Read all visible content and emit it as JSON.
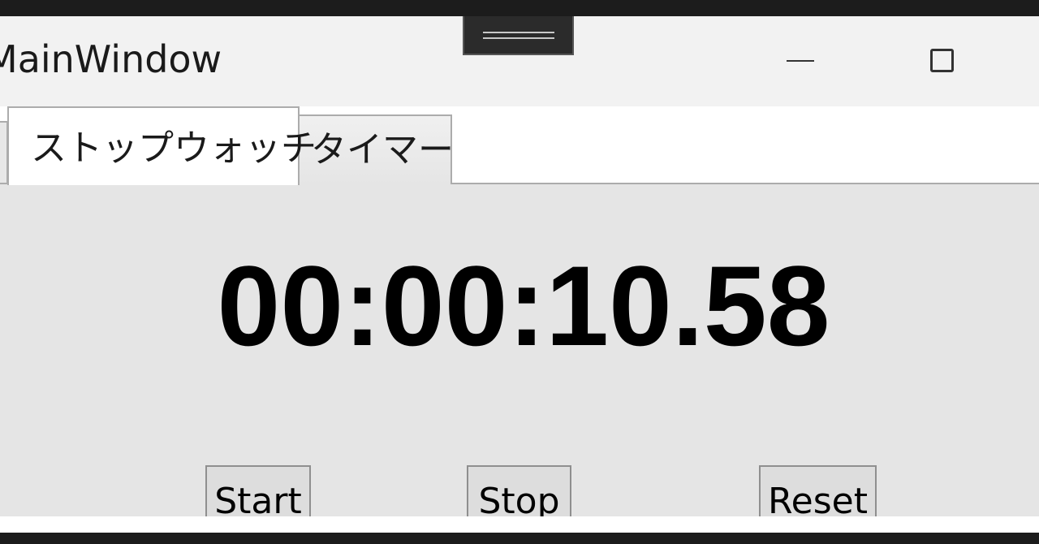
{
  "window": {
    "title": "MainWindow"
  },
  "title_controls": {
    "minimize_icon": "minimize-icon",
    "maximize_icon": "maximize-icon"
  },
  "tabs": [
    {
      "label": "ストップウォッチ",
      "selected": true
    },
    {
      "label": "タイマー",
      "selected": false
    }
  ],
  "stopwatch": {
    "time": "00:00:10.58"
  },
  "buttons": {
    "start_label": "Start",
    "stop_label": "Stop",
    "reset_label": "Reset"
  },
  "colors": {
    "content_background": "#e5e5e5",
    "titlebar_background": "#f2f2f2",
    "time_text": "#000000"
  }
}
